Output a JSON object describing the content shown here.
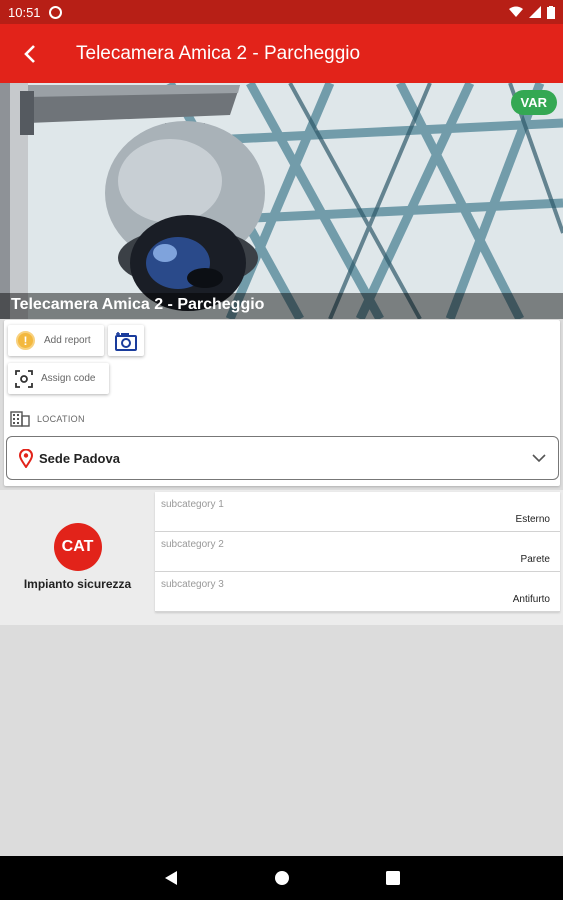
{
  "status_bar": {
    "time": "10:51"
  },
  "app_bar": {
    "title": "Telecamera Amica 2 - Parcheggio"
  },
  "hero": {
    "badge": "VAR",
    "caption": "Telecamera Amica 2 - Parcheggio"
  },
  "actions": {
    "add_report": "Add report",
    "assign_code": "Assign code"
  },
  "location": {
    "label": "LOCATION",
    "value": "Sede Padova"
  },
  "category": {
    "badge": "CAT",
    "name": "Impianto sicurezza",
    "badge_color": "#e2231a",
    "subcategories": [
      {
        "label": "subcategory 1",
        "value": "Esterno"
      },
      {
        "label": "subcategory 2",
        "value": "Parete"
      },
      {
        "label": "subcategory 3",
        "value": "Antifurto"
      }
    ]
  },
  "colors": {
    "app_bar": "#e2231a",
    "status_bar": "#b71f16",
    "badge": "#34a853"
  }
}
